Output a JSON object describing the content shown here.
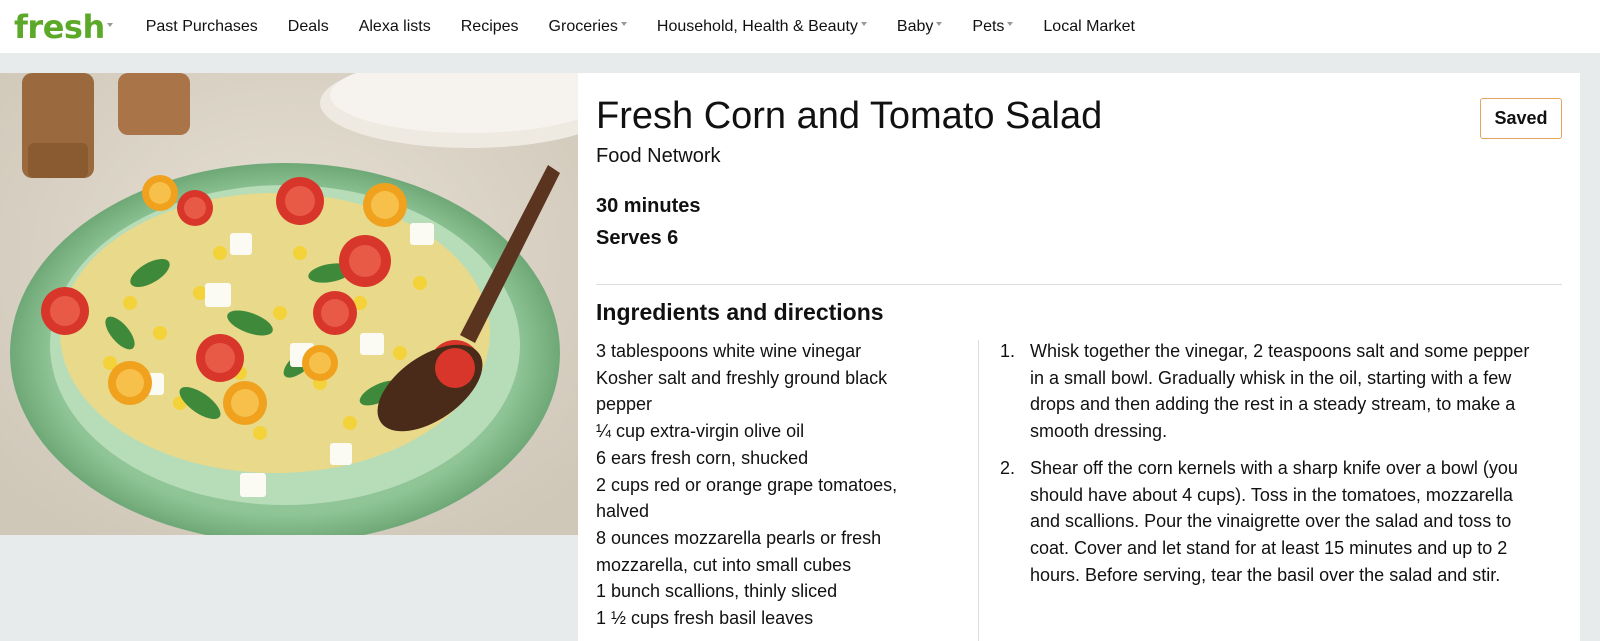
{
  "nav": {
    "logo": "fresh",
    "items": [
      {
        "label": "Past Purchases",
        "dropdown": false
      },
      {
        "label": "Deals",
        "dropdown": false
      },
      {
        "label": "Alexa lists",
        "dropdown": false
      },
      {
        "label": "Recipes",
        "dropdown": false
      },
      {
        "label": "Groceries",
        "dropdown": true
      },
      {
        "label": "Household, Health & Beauty",
        "dropdown": true
      },
      {
        "label": "Baby",
        "dropdown": true
      },
      {
        "label": "Pets",
        "dropdown": true
      },
      {
        "label": "Local Market",
        "dropdown": false
      }
    ]
  },
  "recipe": {
    "title": "Fresh Corn and Tomato Salad",
    "source": "Food Network",
    "saved_label": "Saved",
    "time": "30 minutes",
    "serves": "Serves 6",
    "section_title": "Ingredients and directions",
    "ingredients": [
      "3 tablespoons white wine vinegar",
      "Kosher salt and freshly ground black pepper",
      "¼ cup extra-virgin olive oil",
      "6 ears fresh corn, shucked",
      "2 cups red or orange grape tomatoes, halved",
      "8 ounces mozzarella pearls or fresh mozzarella, cut into small cubes",
      "1 bunch scallions, thinly sliced",
      "1 ½ cups fresh basil leaves"
    ],
    "directions": [
      {
        "num": "1.",
        "text": "Whisk together the vinegar, 2 teaspoons salt and some pepper in a small bowl. Gradually whisk in the oil, starting with a few drops and then adding the rest in a steady stream, to make a smooth dressing."
      },
      {
        "num": "2.",
        "text": "Shear off the corn kernels with a sharp knife over a bowl (you should have about 4 cups). Toss in the tomatoes, mozzarella and scallions. Pour the vinaigrette over the salad and toss to coat. Cover and let stand for at least 15 minutes and up to 2 hours. Before serving, tear the basil over the salad and stir."
      }
    ]
  },
  "colors": {
    "brand_green": "#5ca92a",
    "saved_border": "#e3a45b",
    "page_bg": "#e8ebec"
  }
}
